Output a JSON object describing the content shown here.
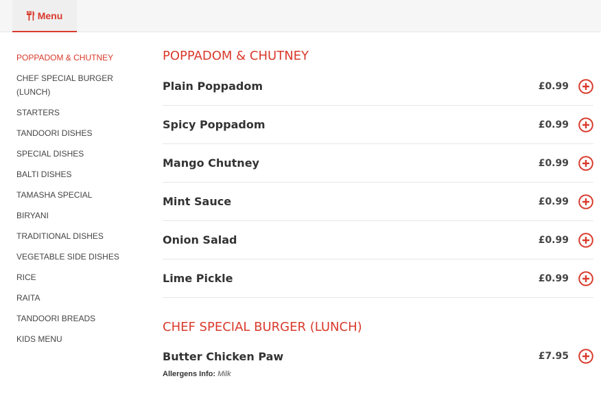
{
  "header": {
    "tab_label": "Menu",
    "tab_icon": "utensils-icon"
  },
  "colors": {
    "accent": "#d9392b"
  },
  "sidebar": {
    "items": [
      {
        "label": "POPPADOM & CHUTNEY",
        "active": true
      },
      {
        "label": "CHEF SPECIAL BURGER (LUNCH)"
      },
      {
        "label": "STARTERS"
      },
      {
        "label": "TANDOORI DISHES"
      },
      {
        "label": "SPECIAL DISHES"
      },
      {
        "label": "BALTI DISHES"
      },
      {
        "label": "TAMASHA SPECIAL"
      },
      {
        "label": "BIRYANI"
      },
      {
        "label": "TRADITIONAL DISHES"
      },
      {
        "label": "VEGETABLE SIDE DISHES"
      },
      {
        "label": "RICE"
      },
      {
        "label": "RAITA"
      },
      {
        "label": "TANDOORI BREADS"
      },
      {
        "label": "KIDS MENU"
      }
    ]
  },
  "sections": [
    {
      "title": "POPPADOM & CHUTNEY",
      "items": [
        {
          "name": "Plain Poppadom",
          "price": "£0.99"
        },
        {
          "name": "Spicy Poppadom",
          "price": "£0.99"
        },
        {
          "name": "Mango Chutney",
          "price": "£0.99"
        },
        {
          "name": "Mint Sauce",
          "price": "£0.99"
        },
        {
          "name": "Onion Salad",
          "price": "£0.99"
        },
        {
          "name": "Lime Pickle",
          "price": "£0.99"
        }
      ]
    },
    {
      "title": "CHEF SPECIAL BURGER (LUNCH)",
      "items": [
        {
          "name": "Butter Chicken Paw",
          "price": "£7.95",
          "allergen_label": "Allergens Info:",
          "allergen_value": "Milk"
        }
      ]
    }
  ]
}
